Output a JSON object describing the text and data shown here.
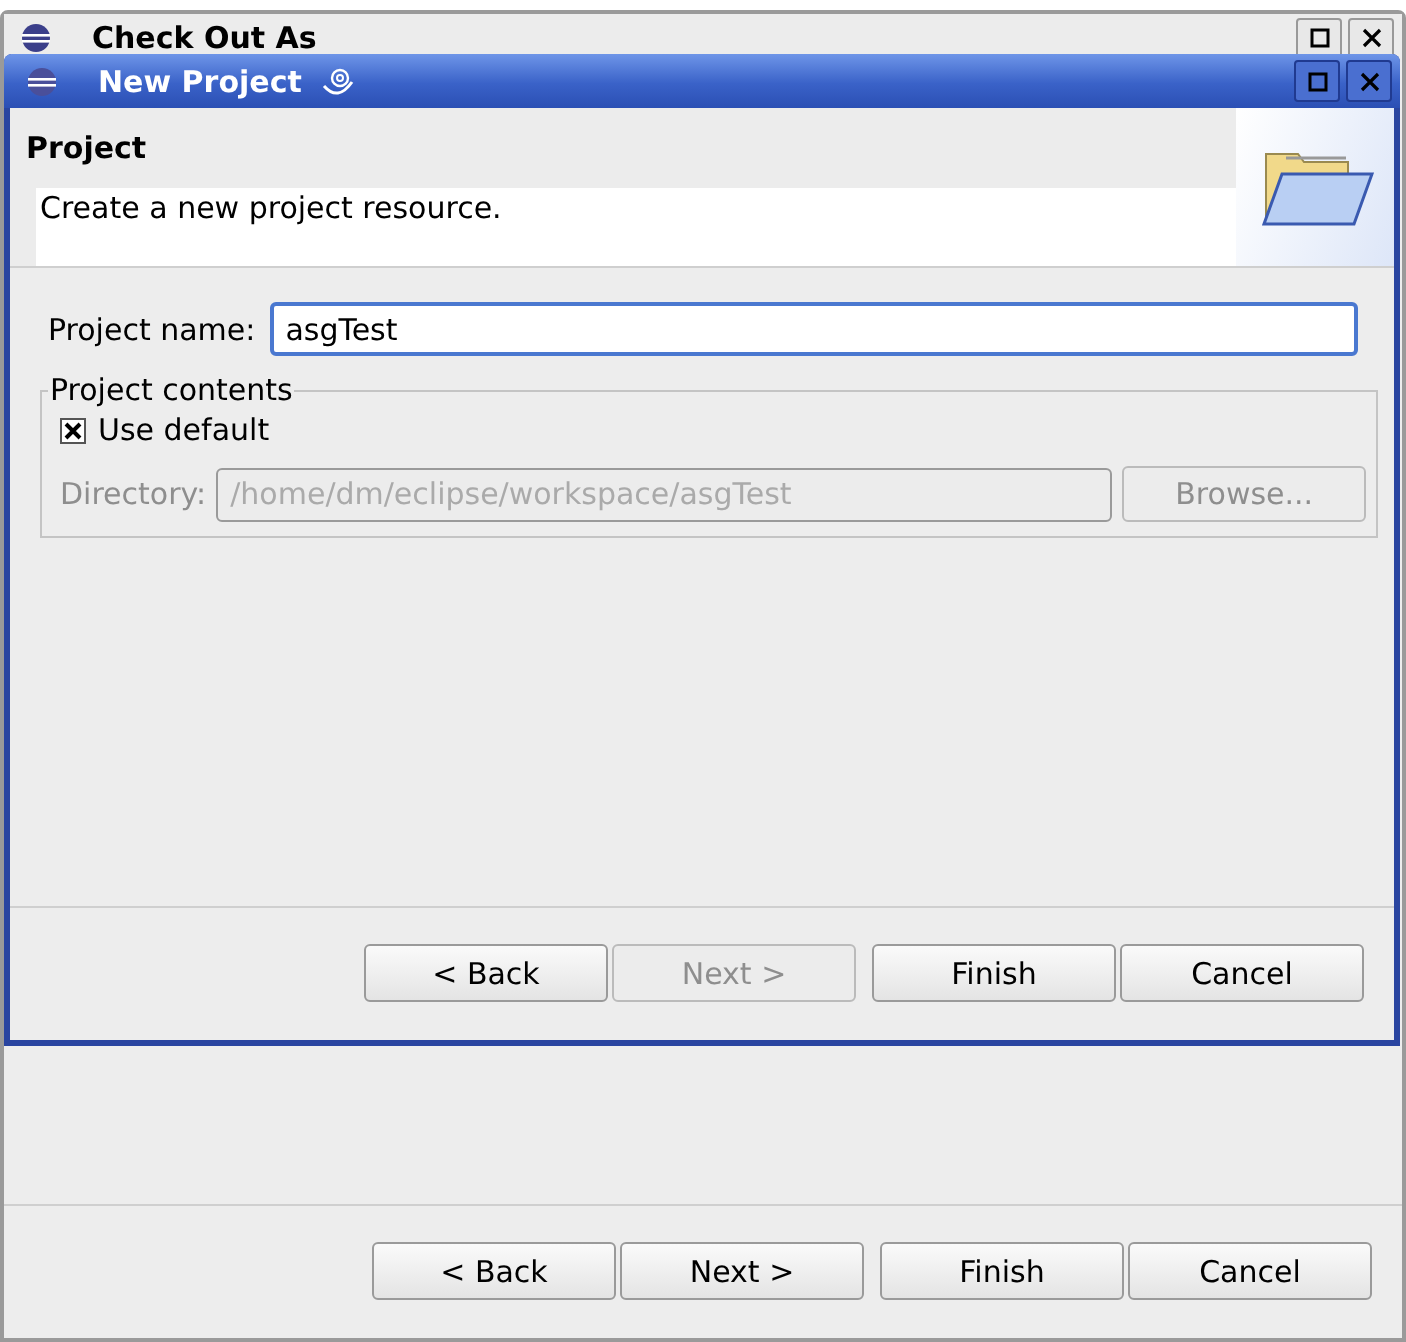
{
  "back_window": {
    "title": "Check Out As",
    "buttons": [
      {
        "label": "< Back",
        "disabled": false
      },
      {
        "label": "Next >",
        "disabled": false
      },
      {
        "label": "Finish",
        "disabled": false
      },
      {
        "label": "Cancel",
        "disabled": false
      }
    ]
  },
  "window": {
    "title": "New Project",
    "header": {
      "title": "Project",
      "description": "Create a new project resource."
    },
    "project_name": {
      "label": "Project name:",
      "value": "asgTest"
    },
    "project_contents": {
      "title": "Project contents",
      "use_default": {
        "label": "Use default",
        "checked": true
      },
      "directory": {
        "label": "Directory:",
        "value": "/home/dm/eclipse/workspace/asgTest",
        "disabled": true
      },
      "browse": {
        "label": "Browse...",
        "disabled": true
      }
    },
    "buttons": [
      {
        "label": "< Back",
        "disabled": false
      },
      {
        "label": "Next >",
        "disabled": true
      },
      {
        "label": "Finish",
        "disabled": false
      },
      {
        "label": "Cancel",
        "disabled": false
      }
    ]
  }
}
